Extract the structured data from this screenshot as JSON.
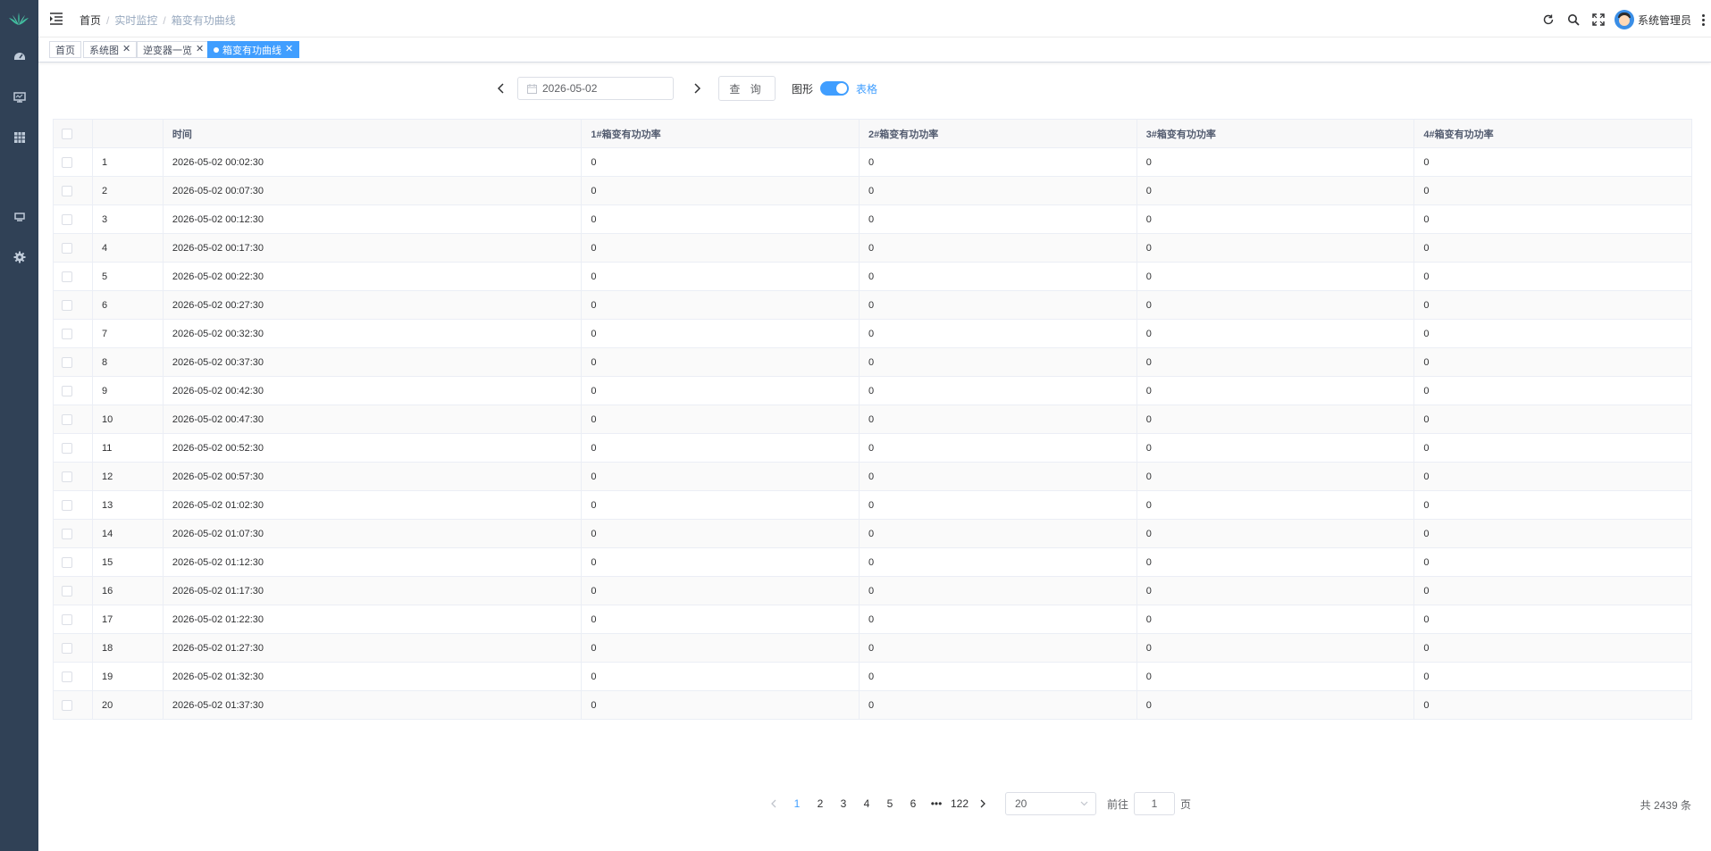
{
  "sidebar": {
    "logo_icon": "plant-logo-icon",
    "items": [
      {
        "icon": "dashboard-icon"
      },
      {
        "icon": "monitor-icon"
      },
      {
        "icon": "table-icon"
      },
      {
        "icon": "report-icon"
      },
      {
        "icon": "gear-icon"
      }
    ]
  },
  "header": {
    "breadcrumb": [
      "首页",
      "实时监控",
      "箱变有功曲线"
    ],
    "user_name": "系统管理员"
  },
  "tags": [
    {
      "label": "首页",
      "closable": false,
      "active": false
    },
    {
      "label": "系统图",
      "closable": true,
      "active": false
    },
    {
      "label": "逆变器一览",
      "closable": true,
      "active": false
    },
    {
      "label": "箱变有功曲线",
      "closable": true,
      "active": true
    }
  ],
  "query": {
    "date": "2026-05-02",
    "query_label": "查 询",
    "chart_label": "图形",
    "table_label": "表格",
    "accent": "#409eff"
  },
  "table": {
    "columns": [
      "",
      "",
      "时间",
      "1#箱变有功功率",
      "2#箱变有功功率",
      "3#箱变有功功率",
      "4#箱变有功功率"
    ],
    "rows": [
      [
        "1",
        "2026-05-02 00:02:30",
        "0",
        "0",
        "0",
        "0"
      ],
      [
        "2",
        "2026-05-02 00:07:30",
        "0",
        "0",
        "0",
        "0"
      ],
      [
        "3",
        "2026-05-02 00:12:30",
        "0",
        "0",
        "0",
        "0"
      ],
      [
        "4",
        "2026-05-02 00:17:30",
        "0",
        "0",
        "0",
        "0"
      ],
      [
        "5",
        "2026-05-02 00:22:30",
        "0",
        "0",
        "0",
        "0"
      ],
      [
        "6",
        "2026-05-02 00:27:30",
        "0",
        "0",
        "0",
        "0"
      ],
      [
        "7",
        "2026-05-02 00:32:30",
        "0",
        "0",
        "0",
        "0"
      ],
      [
        "8",
        "2026-05-02 00:37:30",
        "0",
        "0",
        "0",
        "0"
      ],
      [
        "9",
        "2026-05-02 00:42:30",
        "0",
        "0",
        "0",
        "0"
      ],
      [
        "10",
        "2026-05-02 00:47:30",
        "0",
        "0",
        "0",
        "0"
      ],
      [
        "11",
        "2026-05-02 00:52:30",
        "0",
        "0",
        "0",
        "0"
      ],
      [
        "12",
        "2026-05-02 00:57:30",
        "0",
        "0",
        "0",
        "0"
      ],
      [
        "13",
        "2026-05-02 01:02:30",
        "0",
        "0",
        "0",
        "0"
      ],
      [
        "14",
        "2026-05-02 01:07:30",
        "0",
        "0",
        "0",
        "0"
      ],
      [
        "15",
        "2026-05-02 01:12:30",
        "0",
        "0",
        "0",
        "0"
      ],
      [
        "16",
        "2026-05-02 01:17:30",
        "0",
        "0",
        "0",
        "0"
      ],
      [
        "17",
        "2026-05-02 01:22:30",
        "0",
        "0",
        "0",
        "0"
      ],
      [
        "18",
        "2026-05-02 01:27:30",
        "0",
        "0",
        "0",
        "0"
      ],
      [
        "19",
        "2026-05-02 01:32:30",
        "0",
        "0",
        "0",
        "0"
      ],
      [
        "20",
        "2026-05-02 01:37:30",
        "0",
        "0",
        "0",
        "0"
      ]
    ]
  },
  "pagination": {
    "pages": [
      "1",
      "2",
      "3",
      "4",
      "5",
      "6",
      "•••",
      "122"
    ],
    "current": "1",
    "page_size": "20",
    "goto_label": "前往",
    "goto_value": "1",
    "page_suffix": "页",
    "total": "共 2439 条"
  }
}
